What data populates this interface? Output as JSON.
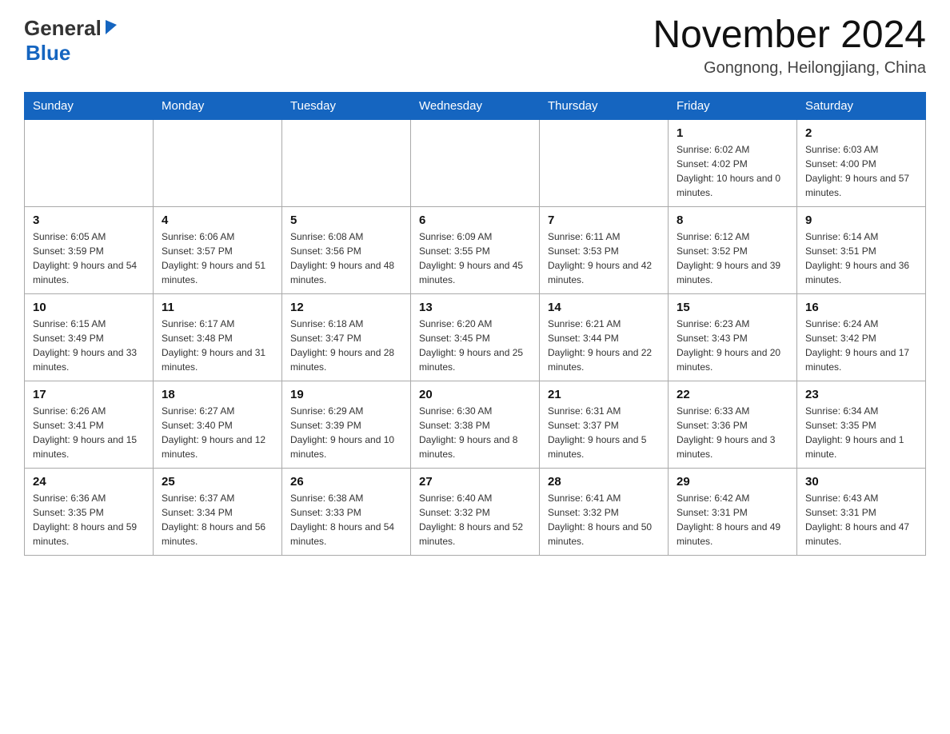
{
  "header": {
    "logo_general": "General",
    "logo_blue": "Blue",
    "month_title": "November 2024",
    "location": "Gongnong, Heilongjiang, China"
  },
  "weekdays": [
    "Sunday",
    "Monday",
    "Tuesday",
    "Wednesday",
    "Thursday",
    "Friday",
    "Saturday"
  ],
  "weeks": [
    [
      {
        "day": "",
        "info": ""
      },
      {
        "day": "",
        "info": ""
      },
      {
        "day": "",
        "info": ""
      },
      {
        "day": "",
        "info": ""
      },
      {
        "day": "",
        "info": ""
      },
      {
        "day": "1",
        "info": "Sunrise: 6:02 AM\nSunset: 4:02 PM\nDaylight: 10 hours and 0 minutes."
      },
      {
        "day": "2",
        "info": "Sunrise: 6:03 AM\nSunset: 4:00 PM\nDaylight: 9 hours and 57 minutes."
      }
    ],
    [
      {
        "day": "3",
        "info": "Sunrise: 6:05 AM\nSunset: 3:59 PM\nDaylight: 9 hours and 54 minutes."
      },
      {
        "day": "4",
        "info": "Sunrise: 6:06 AM\nSunset: 3:57 PM\nDaylight: 9 hours and 51 minutes."
      },
      {
        "day": "5",
        "info": "Sunrise: 6:08 AM\nSunset: 3:56 PM\nDaylight: 9 hours and 48 minutes."
      },
      {
        "day": "6",
        "info": "Sunrise: 6:09 AM\nSunset: 3:55 PM\nDaylight: 9 hours and 45 minutes."
      },
      {
        "day": "7",
        "info": "Sunrise: 6:11 AM\nSunset: 3:53 PM\nDaylight: 9 hours and 42 minutes."
      },
      {
        "day": "8",
        "info": "Sunrise: 6:12 AM\nSunset: 3:52 PM\nDaylight: 9 hours and 39 minutes."
      },
      {
        "day": "9",
        "info": "Sunrise: 6:14 AM\nSunset: 3:51 PM\nDaylight: 9 hours and 36 minutes."
      }
    ],
    [
      {
        "day": "10",
        "info": "Sunrise: 6:15 AM\nSunset: 3:49 PM\nDaylight: 9 hours and 33 minutes."
      },
      {
        "day": "11",
        "info": "Sunrise: 6:17 AM\nSunset: 3:48 PM\nDaylight: 9 hours and 31 minutes."
      },
      {
        "day": "12",
        "info": "Sunrise: 6:18 AM\nSunset: 3:47 PM\nDaylight: 9 hours and 28 minutes."
      },
      {
        "day": "13",
        "info": "Sunrise: 6:20 AM\nSunset: 3:45 PM\nDaylight: 9 hours and 25 minutes."
      },
      {
        "day": "14",
        "info": "Sunrise: 6:21 AM\nSunset: 3:44 PM\nDaylight: 9 hours and 22 minutes."
      },
      {
        "day": "15",
        "info": "Sunrise: 6:23 AM\nSunset: 3:43 PM\nDaylight: 9 hours and 20 minutes."
      },
      {
        "day": "16",
        "info": "Sunrise: 6:24 AM\nSunset: 3:42 PM\nDaylight: 9 hours and 17 minutes."
      }
    ],
    [
      {
        "day": "17",
        "info": "Sunrise: 6:26 AM\nSunset: 3:41 PM\nDaylight: 9 hours and 15 minutes."
      },
      {
        "day": "18",
        "info": "Sunrise: 6:27 AM\nSunset: 3:40 PM\nDaylight: 9 hours and 12 minutes."
      },
      {
        "day": "19",
        "info": "Sunrise: 6:29 AM\nSunset: 3:39 PM\nDaylight: 9 hours and 10 minutes."
      },
      {
        "day": "20",
        "info": "Sunrise: 6:30 AM\nSunset: 3:38 PM\nDaylight: 9 hours and 8 minutes."
      },
      {
        "day": "21",
        "info": "Sunrise: 6:31 AM\nSunset: 3:37 PM\nDaylight: 9 hours and 5 minutes."
      },
      {
        "day": "22",
        "info": "Sunrise: 6:33 AM\nSunset: 3:36 PM\nDaylight: 9 hours and 3 minutes."
      },
      {
        "day": "23",
        "info": "Sunrise: 6:34 AM\nSunset: 3:35 PM\nDaylight: 9 hours and 1 minute."
      }
    ],
    [
      {
        "day": "24",
        "info": "Sunrise: 6:36 AM\nSunset: 3:35 PM\nDaylight: 8 hours and 59 minutes."
      },
      {
        "day": "25",
        "info": "Sunrise: 6:37 AM\nSunset: 3:34 PM\nDaylight: 8 hours and 56 minutes."
      },
      {
        "day": "26",
        "info": "Sunrise: 6:38 AM\nSunset: 3:33 PM\nDaylight: 8 hours and 54 minutes."
      },
      {
        "day": "27",
        "info": "Sunrise: 6:40 AM\nSunset: 3:32 PM\nDaylight: 8 hours and 52 minutes."
      },
      {
        "day": "28",
        "info": "Sunrise: 6:41 AM\nSunset: 3:32 PM\nDaylight: 8 hours and 50 minutes."
      },
      {
        "day": "29",
        "info": "Sunrise: 6:42 AM\nSunset: 3:31 PM\nDaylight: 8 hours and 49 minutes."
      },
      {
        "day": "30",
        "info": "Sunrise: 6:43 AM\nSunset: 3:31 PM\nDaylight: 8 hours and 47 minutes."
      }
    ]
  ]
}
